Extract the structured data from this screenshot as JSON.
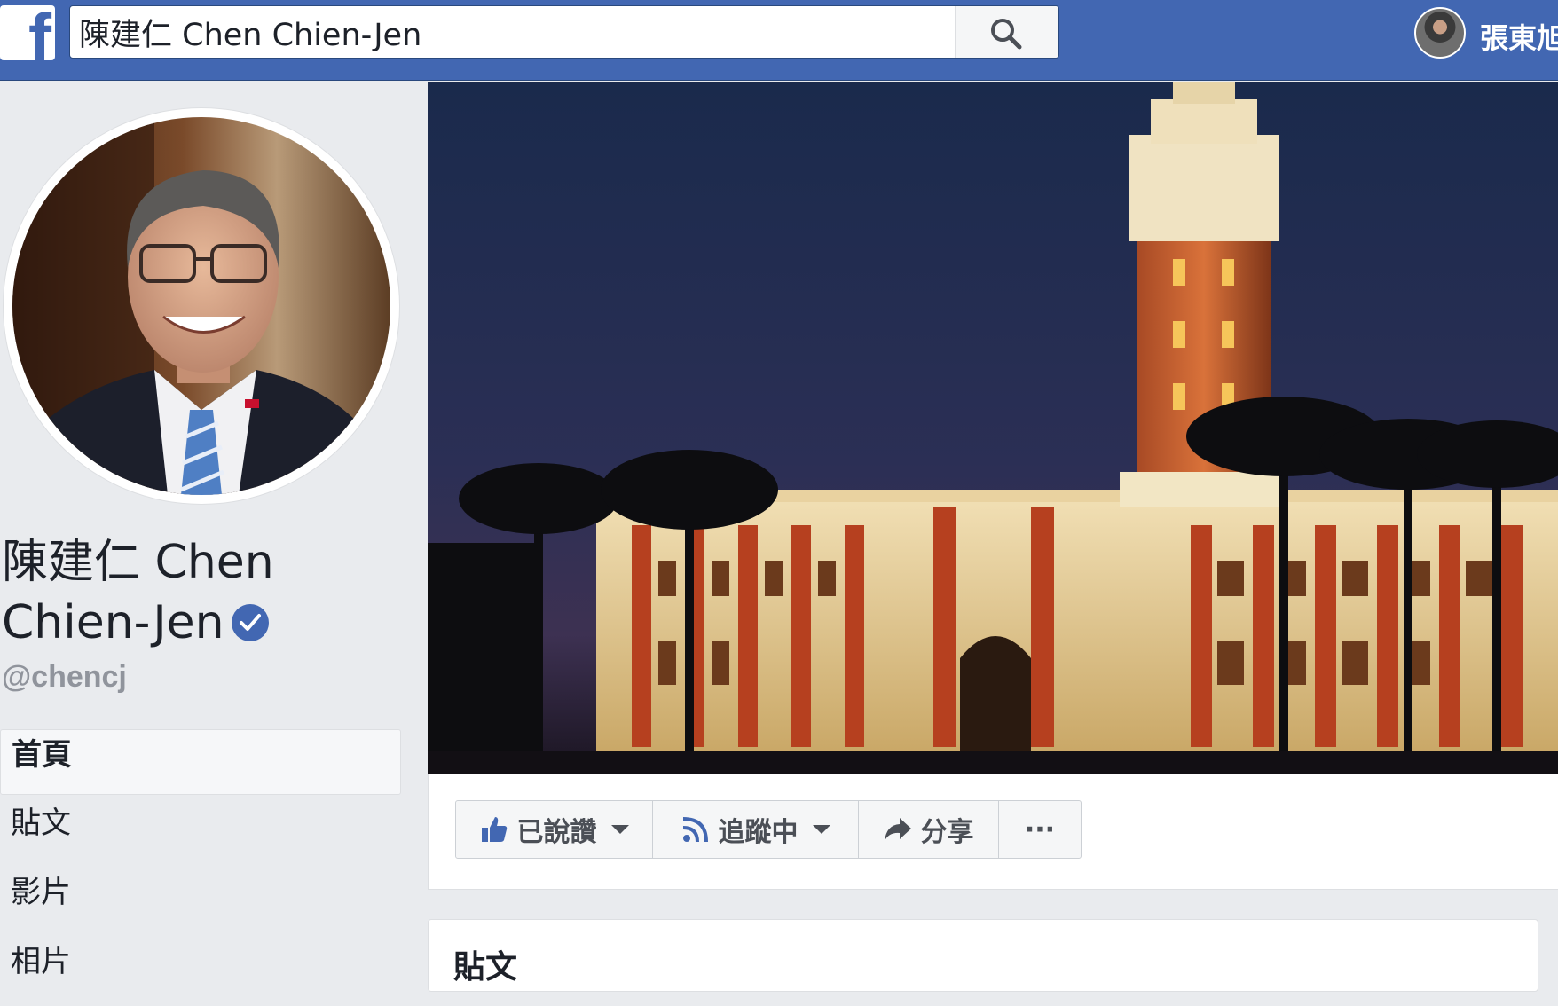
{
  "search": {
    "value": "陳建仁 Chen Chien-Jen"
  },
  "user": {
    "name": "張東旭"
  },
  "page": {
    "name_line1": "陳建仁 Chen",
    "name_line2": "Chien-Jen",
    "handle": "@chencj"
  },
  "nav": {
    "items": [
      "首頁",
      "貼文",
      "影片",
      "相片"
    ]
  },
  "actions": {
    "like": "已說讚",
    "follow": "追蹤中",
    "share": "分享",
    "more": "···"
  },
  "posts": {
    "title": "貼文"
  },
  "colors": {
    "brand": "#4267b2",
    "background": "#e9ebee",
    "verified": "#4267b2"
  },
  "icons": [
    "facebook-logo-icon",
    "search-icon",
    "verified-badge-icon",
    "thumbs-up-icon",
    "rss-follow-icon",
    "share-arrow-icon",
    "more-dots-icon"
  ]
}
